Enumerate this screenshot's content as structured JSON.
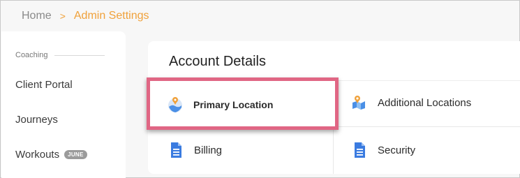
{
  "breadcrumb": {
    "home": "Home",
    "separator": ">",
    "current": "Admin Settings"
  },
  "sidebar": {
    "section": "Coaching",
    "items": [
      {
        "label": "Client Portal"
      },
      {
        "label": "Journeys"
      },
      {
        "label": "Workouts",
        "badge": "JUNE"
      }
    ]
  },
  "panel": {
    "title": "Account Details",
    "tiles": [
      {
        "label": "Primary Location",
        "icon": "location-globe-icon"
      },
      {
        "label": "Additional Locations",
        "icon": "map-pin-icon"
      },
      {
        "label": "Billing",
        "icon": "document-icon"
      },
      {
        "label": "Security",
        "icon": "document-icon"
      }
    ]
  },
  "colors": {
    "accent": "#f0a13a",
    "highlight": "#e06684",
    "doc_icon": "#3a7be0"
  }
}
